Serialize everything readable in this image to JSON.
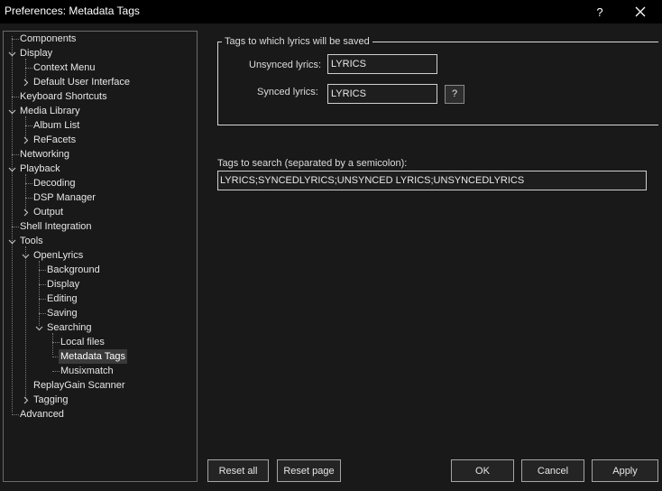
{
  "window": {
    "title": "Preferences: Metadata Tags",
    "help_label": "?"
  },
  "tree": {
    "components": "Components",
    "display": "Display",
    "context_menu": "Context Menu",
    "default_ui": "Default User Interface",
    "keyboard_shortcuts": "Keyboard Shortcuts",
    "media_library": "Media Library",
    "album_list": "Album List",
    "refacets": "ReFacets",
    "networking": "Networking",
    "playback": "Playback",
    "decoding": "Decoding",
    "dsp_manager": "DSP Manager",
    "output": "Output",
    "shell_integration": "Shell Integration",
    "tools": "Tools",
    "openlyrics": "OpenLyrics",
    "background": "Background",
    "ol_display": "Display",
    "editing": "Editing",
    "saving": "Saving",
    "searching": "Searching",
    "local_files": "Local files",
    "metadata_tags": "Metadata Tags",
    "musixmatch": "Musixmatch",
    "replaygain": "ReplayGain Scanner",
    "tagging": "Tagging",
    "advanced": "Advanced"
  },
  "save_group": {
    "legend": "Tags to which lyrics will be saved",
    "unsynced_label": "Unsynced lyrics:",
    "unsynced_value": "LYRICS",
    "synced_label": "Synced lyrics:",
    "synced_value": "LYRICS",
    "help_button": "?"
  },
  "search": {
    "label": "Tags to search (separated by a semicolon):",
    "value": "LYRICS;SYNCEDLYRICS;UNSYNCED LYRICS;UNSYNCEDLYRICS"
  },
  "buttons": {
    "reset_all": "Reset all",
    "reset_page": "Reset page",
    "ok": "OK",
    "cancel": "Cancel",
    "apply": "Apply"
  }
}
